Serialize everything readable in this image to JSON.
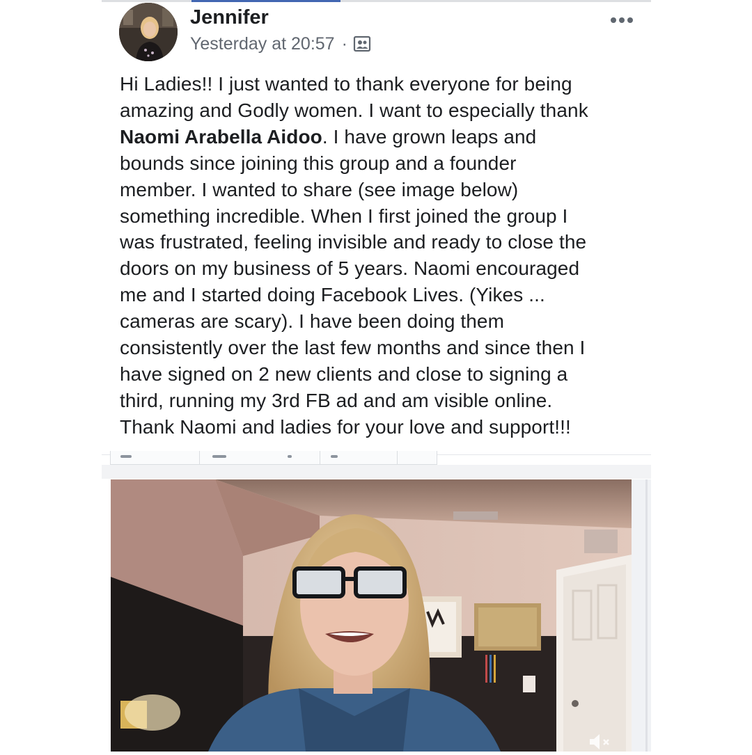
{
  "post": {
    "author": "Jennifer",
    "timestamp": "Yesterday at 20:57",
    "separator": "·",
    "audience_icon": "group-audience-icon",
    "more_icon": "more-options-icon",
    "text_lines": {
      "l1": "Hi Ladies!!  I just wanted to thank everyone for being",
      "l2": "amazing and Godly women.  I want to especially thank",
      "l3_mention": "Naomi Arabella Aidoo",
      "l3_rest": ".  I have grown leaps and",
      "l4": "bounds since joining this group and a founder",
      "l5": "member.  I wanted to share (see image below)",
      "l6": "something incredible.  When I first joined the group I",
      "l7": "was frustrated, feeling invisible and ready to close the",
      "l8": "doors on my business of 5 years.  Naomi encouraged",
      "l9": "me and I started doing Facebook Lives.  (Yikes ...",
      "l10": "cameras are scary).  I have been doing them",
      "l11": "consistently over the last few months and since then I",
      "l12": "have signed on 2 new clients and close to signing a",
      "l13": "third, running my 3rd FB ad and am visible online.",
      "l14": "Thank Naomi and ladies for your love and support!!!"
    }
  },
  "video": {
    "mute_icon": "volume-muted-icon"
  },
  "colors": {
    "accent": "#4267b2",
    "text": "#1c1e21",
    "meta_text": "#616770"
  }
}
